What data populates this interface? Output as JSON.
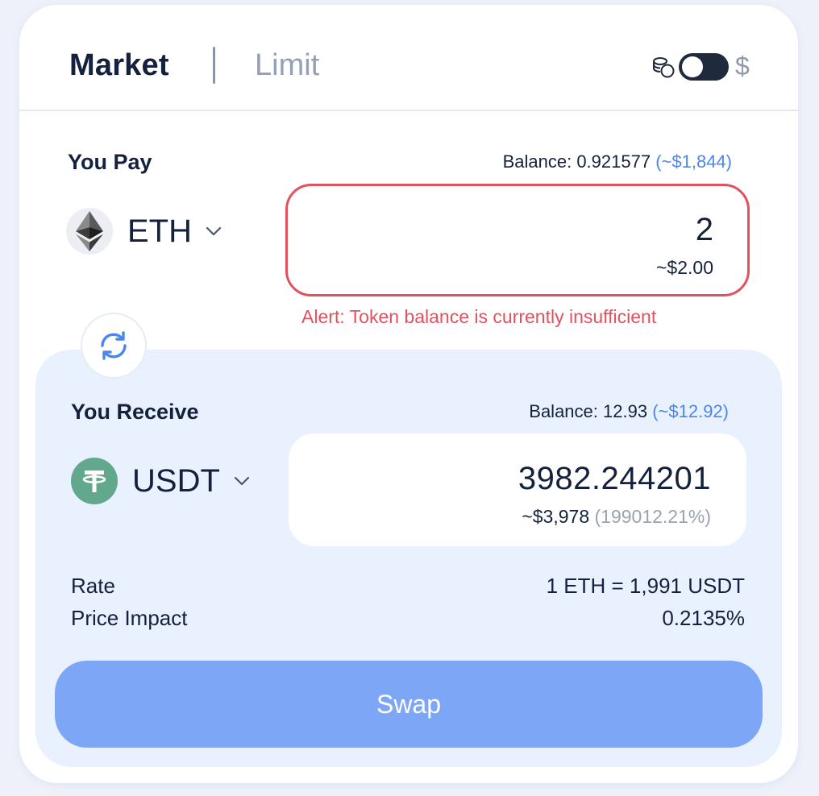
{
  "header": {
    "tabs": [
      {
        "label": "Market",
        "active": true
      },
      {
        "label": "Limit",
        "active": false
      }
    ],
    "toggle_label": "$",
    "toggle_on": false,
    "icons": [
      "coins-icon",
      "toggle",
      "dollar"
    ]
  },
  "pay": {
    "label": "You Pay",
    "balance_label": "Balance:",
    "balance_value": "0.921577",
    "balance_fiat": "(~$1,844)",
    "token": "ETH",
    "amount": "2",
    "fiat": "~$2.00",
    "alert": "Alert: Token balance is currently insufficient"
  },
  "receive": {
    "label": "You Receive",
    "balance_label": "Balance:",
    "balance_value": "12.93",
    "balance_fiat": "(~$12.92)",
    "token": "USDT",
    "amount": "3982.244201",
    "fiat": "~$3,978",
    "fiat_pct": "(199012.21%)"
  },
  "details": {
    "rate_label": "Rate",
    "rate_value": "1 ETH = 1,991 USDT",
    "impact_label": "Price Impact",
    "impact_value": "0.2135%"
  },
  "action": {
    "swap_label": "Swap"
  },
  "colors": {
    "accent": "#4a86f0",
    "error": "#e2515e",
    "button": "#7ea6f7",
    "panel": "#eaf1fe",
    "text": "#14213d",
    "usdt": "#62a88d"
  }
}
